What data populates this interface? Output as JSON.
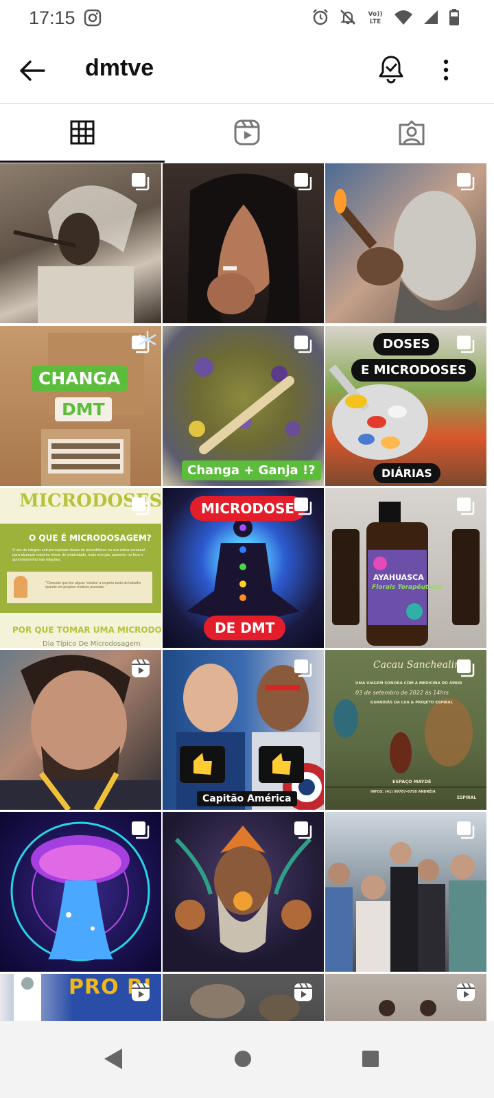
{
  "status_bar": {
    "time": "17:15"
  },
  "header": {
    "username": "dmtve"
  },
  "tabs": [
    {
      "name": "posts",
      "icon": "grid-icon",
      "active": true
    },
    {
      "name": "reels",
      "icon": "reels-icon",
      "active": false
    },
    {
      "name": "tagged",
      "icon": "tagged-icon",
      "active": false
    }
  ],
  "posts": {
    "p4": {
      "label1": "CHANGA",
      "label2": "DMT"
    },
    "p5": {
      "label": "Changa + Ganja !?"
    },
    "p6": {
      "label1": "DOSES",
      "label2": "E MICRODOSES",
      "label3": "DIÁRIAS"
    },
    "p7": {
      "title": "MICRODOSES",
      "heading": "O QUE É MICRODOSAGEM?",
      "body": "O ato de integrar sub-perceptuais doses de psicodélicos na sua rotina semanal para alcançar maiores níveis de criatividade, mais energia, aumento no foco e aprimoramento nas relações.",
      "quote": "\" Descobri que tive alguns 'estalos' a respeito tanto do trabalho quando em projetos criativos pessoais. \"",
      "footer": "POR QUE TOMAR UMA MICRODOSE?",
      "footer2": "Dia Típico De Microdosagem"
    },
    "p8": {
      "label1": "MICRODOSE",
      "label2": "DE DMT"
    },
    "p9": {
      "label1": "AYAHUASCA",
      "label2": "Florais Terapêuticos"
    },
    "p11": {
      "label": "Capitão América"
    },
    "p12": {
      "title": "Cacau Sanchealing",
      "sub": "UMA VIAGEM SONORA COM A MEDICINA DO AMOR",
      "date": "03 de setembro de 2022 às 14hrs",
      "org": "GUARDIÃS DA LUA & PROJETO ESPIRAL",
      "place": "ESPAÇO MAYDÊ",
      "info": "INFOS: (41) 99787-6758 ANDRÉIA",
      "logo": "ESPIRAL"
    },
    "p16": {
      "label": "PRO RI"
    }
  },
  "colors": {
    "accent_green": "#5cbd3c",
    "accent_red": "#e41d2b",
    "badge_bg": "#111111"
  }
}
